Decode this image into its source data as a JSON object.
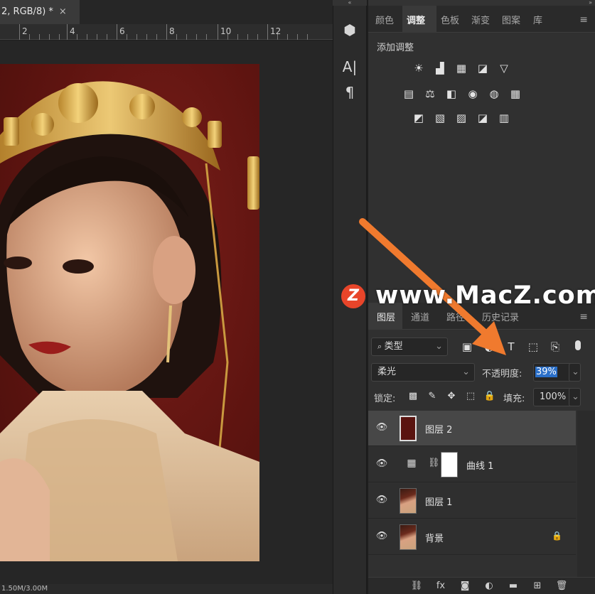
{
  "document_tab": {
    "title": "2, RGB/8) *",
    "close_glyph": "×"
  },
  "ruler": {
    "labels": [
      "2",
      "4",
      "6",
      "8",
      "10",
      "12"
    ]
  },
  "status": {
    "doc_size": "1.50M/3.00M"
  },
  "tools": {
    "items": [
      {
        "name": "3d-cube-icon",
        "glyph": "⬢"
      },
      {
        "name": "character-icon",
        "glyph": "A|"
      },
      {
        "name": "paragraph-icon",
        "glyph": "¶"
      }
    ]
  },
  "panel_collapse": {
    "left": "«",
    "right": "»"
  },
  "adjust_panel": {
    "tabs": [
      "颜色",
      "调整",
      "色板",
      "渐变",
      "图案",
      "库"
    ],
    "active_tab": "调整",
    "menu_glyph": "≡",
    "title": "添加调整",
    "row1": [
      {
        "name": "brightness-icon",
        "glyph": "☀"
      },
      {
        "name": "levels-icon",
        "glyph": "▟"
      },
      {
        "name": "curves-icon",
        "glyph": "▦"
      },
      {
        "name": "exposure-icon",
        "glyph": "◪"
      },
      {
        "name": "vibrance-icon",
        "glyph": "▽"
      }
    ],
    "row2": [
      {
        "name": "hue-saturation-icon",
        "glyph": "▤"
      },
      {
        "name": "color-balance-icon",
        "glyph": "⚖"
      },
      {
        "name": "black-white-icon",
        "glyph": "◧"
      },
      {
        "name": "photo-filter-icon",
        "glyph": "◉"
      },
      {
        "name": "channel-mixer-icon",
        "glyph": "◍"
      },
      {
        "name": "color-lookup-icon",
        "glyph": "▦"
      }
    ],
    "row3": [
      {
        "name": "invert-icon",
        "glyph": "◩"
      },
      {
        "name": "posterize-icon",
        "glyph": "▧"
      },
      {
        "name": "threshold-icon",
        "glyph": "▨"
      },
      {
        "name": "selective-color-icon",
        "glyph": "◪"
      },
      {
        "name": "gradient-map-icon",
        "glyph": "▥"
      }
    ]
  },
  "layers_panel": {
    "tabs": [
      "图层",
      "通道",
      "路径",
      "历史记录"
    ],
    "active_tab": "图层",
    "menu_glyph": "≡",
    "filter_label": "类型",
    "filter_icons": [
      {
        "name": "image-filter-icon",
        "glyph": "▣"
      },
      {
        "name": "adjustment-filter-icon",
        "glyph": "◐"
      },
      {
        "name": "type-filter-icon",
        "glyph": "T"
      },
      {
        "name": "shape-filter-icon",
        "glyph": "⬚"
      },
      {
        "name": "smart-object-filter-icon",
        "glyph": "⎘"
      }
    ],
    "blend_mode": "柔光",
    "opacity_label": "不透明度:",
    "opacity_value": "39%",
    "lock_label": "锁定:",
    "lock_icons": [
      {
        "name": "lock-pixels-icon",
        "glyph": "▩"
      },
      {
        "name": "lock-brush-icon",
        "glyph": "✎"
      },
      {
        "name": "lock-move-icon",
        "glyph": "✥"
      },
      {
        "name": "lock-artboard-icon",
        "glyph": "⬚"
      },
      {
        "name": "lock-all-icon",
        "glyph": "🔒"
      }
    ],
    "fill_label": "填充:",
    "fill_value": "100%",
    "layers": [
      {
        "name": "图层 2",
        "selected": true,
        "thumb": "#5a1410"
      },
      {
        "name": "曲线 1",
        "selected": false,
        "thumb": "adjust"
      },
      {
        "name": "图层 1",
        "selected": false,
        "thumb": "photo"
      },
      {
        "name": "背景",
        "selected": false,
        "thumb": "photo",
        "locked": true
      }
    ],
    "bottom_icons": [
      {
        "name": "link-icon",
        "glyph": "⛓"
      },
      {
        "name": "fx-icon",
        "glyph": "fx"
      },
      {
        "name": "mask-icon",
        "glyph": "◙"
      },
      {
        "name": "adjustment-layer-icon",
        "glyph": "◐"
      },
      {
        "name": "group-icon",
        "glyph": "▬"
      },
      {
        "name": "new-layer-icon",
        "glyph": "⊞"
      },
      {
        "name": "trash-icon",
        "glyph": "🗑"
      }
    ]
  },
  "watermark": {
    "logo": "Z",
    "text": "www.MacZ.com"
  },
  "colors": {
    "accent_arrow": "#f07a2e",
    "selected_layer": "#474747",
    "photo_bg": "#5e1410"
  }
}
